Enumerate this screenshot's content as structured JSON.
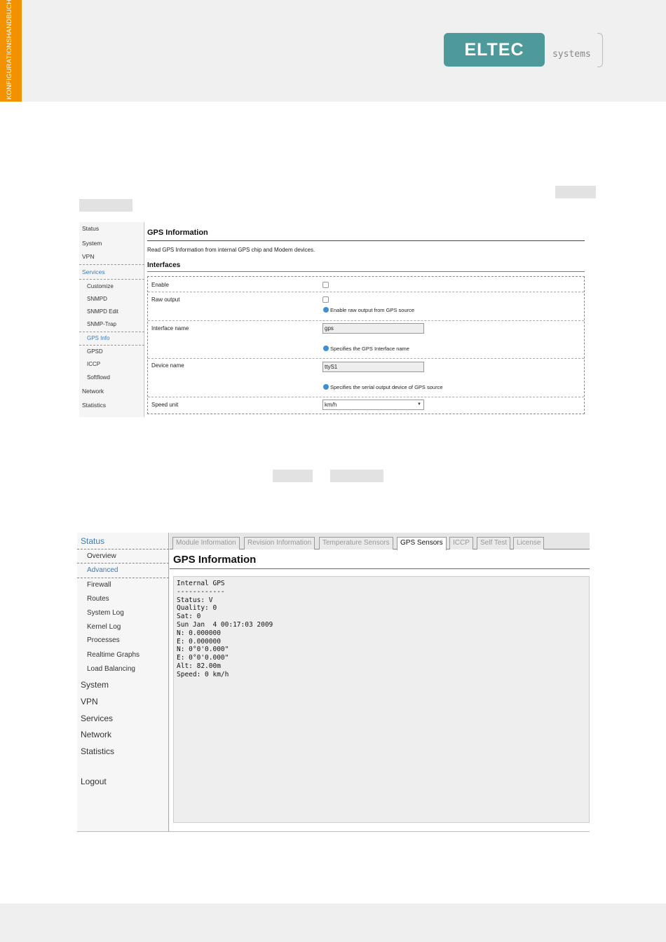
{
  "header": {
    "side_tab": "KONFIGURATIONSHANDBUCH",
    "logo_main": "ELTEC",
    "logo_sub": "systems"
  },
  "gps_config": {
    "nav": {
      "items": [
        "Status",
        "System",
        "VPN",
        "Services"
      ],
      "sub_items": [
        "Customize",
        "SNMPD",
        "SNMPD Edit",
        "SNMP-Trap",
        "GPS Info",
        "GPSD",
        "ICCP",
        "Softflowd"
      ],
      "items_after": [
        "Network",
        "Statistics"
      ]
    },
    "title": "GPS Information",
    "description": "Read GPS Information from internal GPS chip and Modem devices.",
    "section": "Interfaces",
    "fields": {
      "enable_label": "Enable",
      "raw_label": "Raw output",
      "raw_hint": "Enable raw output from GPS source",
      "ifname_label": "Interface name",
      "ifname_value": "gps",
      "ifname_hint": "Specifies the GPS Interface name",
      "device_label": "Device name",
      "device_value": "ttyS1",
      "device_hint": "Specifies the serial output device of GPS source",
      "speed_label": "Speed unit",
      "speed_value": "km/h"
    }
  },
  "gps_status": {
    "nav": {
      "status": "Status",
      "sub_items": [
        "Overview",
        "Advanced",
        "Firewall",
        "Routes",
        "System Log",
        "Kernel Log",
        "Processes",
        "Realtime Graphs",
        "Load Balancing"
      ],
      "items_after": [
        "System",
        "VPN",
        "Services",
        "Network",
        "Statistics"
      ],
      "logout": "Logout"
    },
    "tabs": [
      "Module Information",
      "Revision Information",
      "Temperature Sensors",
      "GPS Sensors",
      "ICCP",
      "Self Test",
      "License"
    ],
    "title": "GPS Information",
    "console": [
      "Internal GPS",
      "------------",
      "Status: V",
      "Quality: 0",
      "Sat: 0",
      "Sun Jan  4 00:17:03 2009",
      "N: 0.000000",
      "E: 0.000000",
      "N: 0°0'0.000\"",
      "E: 0°0'0.000\"",
      "Alt: 82.00m",
      "Speed: 0 km/h"
    ]
  }
}
